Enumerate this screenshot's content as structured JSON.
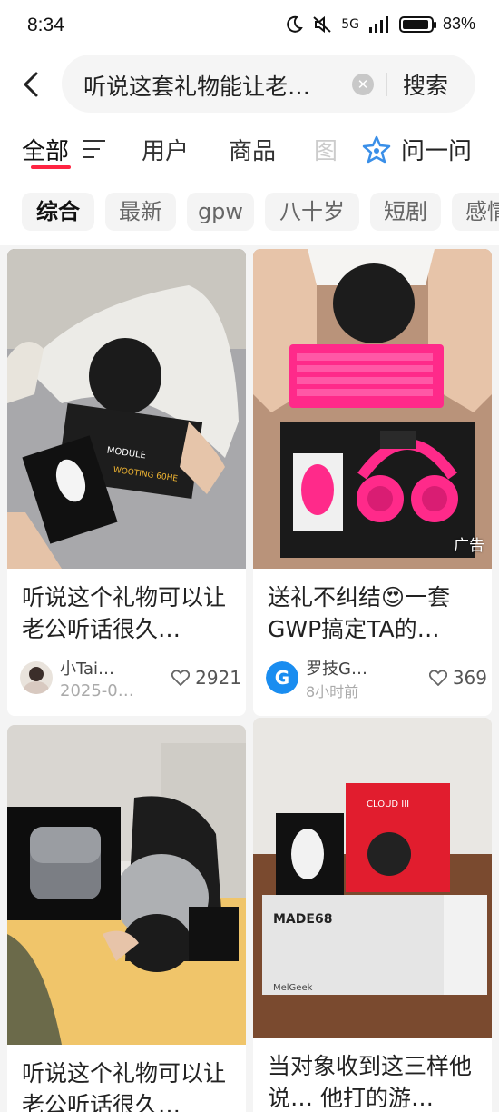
{
  "status_bar": {
    "time": "8:34",
    "network": "5G",
    "battery": "83%"
  },
  "search": {
    "query": "听说这套礼物能让老…",
    "button_label": "搜索"
  },
  "tabs": [
    {
      "label": "全部",
      "active": true
    },
    {
      "label": "用户"
    },
    {
      "label": "商品"
    },
    {
      "label": "图"
    },
    {
      "label": "问一问"
    }
  ],
  "chips": [
    {
      "label": "综合",
      "active": true
    },
    {
      "label": "最新"
    },
    {
      "label": "gpw"
    },
    {
      "label": "八十岁"
    },
    {
      "label": "短剧"
    },
    {
      "label": "感情"
    }
  ],
  "feed": [
    {
      "title": "听说这个礼物可以让老公听话很久…",
      "author": "小Tai…",
      "time": "2025-0…",
      "likes": "2921",
      "ad": ""
    },
    {
      "title": "送礼不纠结😍一套GWP搞定TA的…",
      "author": "罗技G…",
      "time": "8小时前",
      "likes": "369",
      "ad": "广告"
    },
    {
      "title": "听说这个礼物可以让老公听话很久…",
      "author": "",
      "time": "",
      "likes": ""
    },
    {
      "title": "当对象收到这三样他说… 他打的游…",
      "author": "",
      "time": "",
      "likes": ""
    }
  ],
  "colors": {
    "accent": "#ff2442",
    "pink_keyboard": "#ff2a8a",
    "background": "#f4f4f4"
  }
}
